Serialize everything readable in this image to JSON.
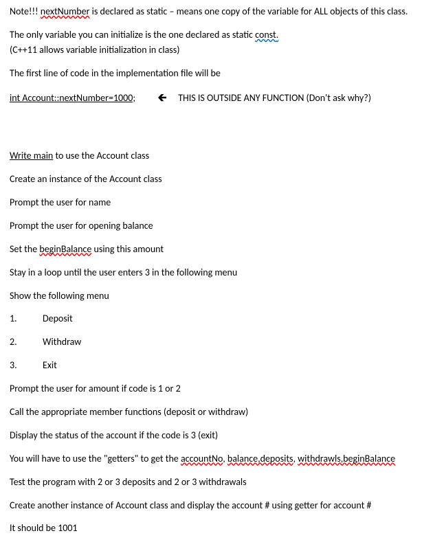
{
  "p1": {
    "a": "Note!!!   ",
    "b": "nextNumber",
    "c": " is declared as static – means one copy of the variable for ALL objects of this class."
  },
  "p2": {
    "a": "The only variable you can initialize is the one declared as static ",
    "b": "const",
    "c": "."
  },
  "p3": "(C++11  allows variable initialization in class)",
  "p4": "The first line of code in the implementation file will be",
  "p5": {
    "a": "int  Account",
    "b": "::",
    "c": "nextNumber",
    "d": "=1000;",
    "e": "THIS IS OUTSIDE ANY FUNCTION (Don't ask why?)"
  },
  "p6": {
    "a": "Write  main",
    "b": " to use the Account class"
  },
  "p7": "Create an instance of the Account class",
  "p8": "Prompt the user for name",
  "p9": "Prompt the user for opening balance",
  "p10": {
    "a": "Set the ",
    "b": "beginBalance",
    "c": " using this amount"
  },
  "p11": "Stay in a loop until the user enters 3 in the following menu",
  "p12": "Show the following menu",
  "menu": [
    {
      "num": "1.",
      "label": "Deposit"
    },
    {
      "num": "2.",
      "label": "Withdraw"
    },
    {
      "num": "3.",
      "label": "Exit"
    }
  ],
  "p13": "Prompt the user for amount if code is 1 or 2",
  "p14": "Call the appropriate member functions (deposit or withdraw)",
  "p15": "Display the status of the account if the code is 3 (exit)",
  "p16": {
    "a": "You will have to use the \"getters\" to get the ",
    "b": "accountNo",
    "c": ", ",
    "d": "balance,deposits",
    "e": ", ",
    "f": "withdrawls,beginBalance"
  },
  "p17": "Test the program with 2 or 3 deposits and 2 or 3 withdrawals",
  "p18": "Create another instance of Account class and display the account # using getter for account #",
  "p19": "It should be 1001"
}
